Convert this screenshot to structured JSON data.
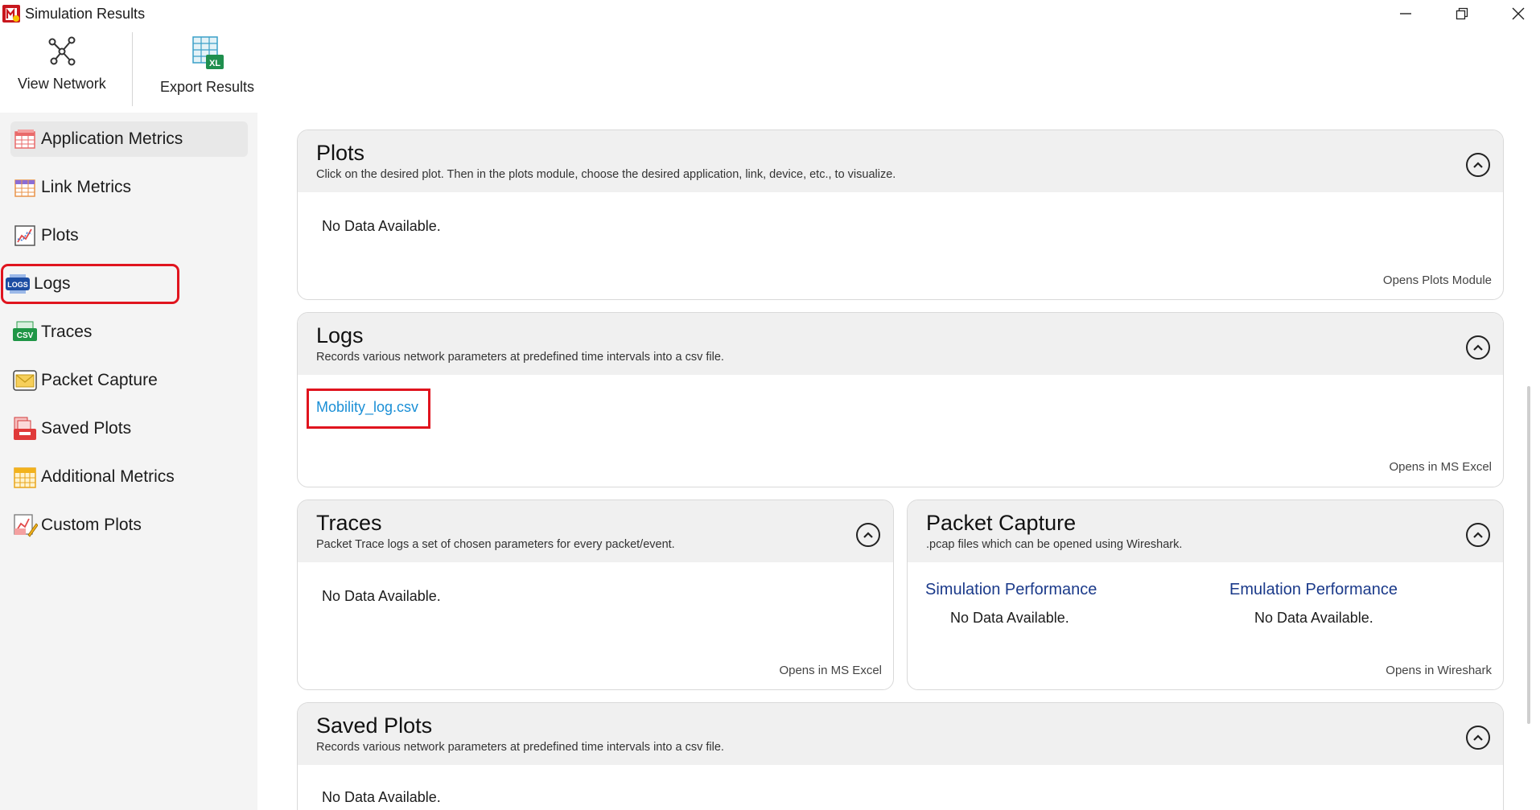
{
  "window": {
    "title": "Simulation Results"
  },
  "toolbar": {
    "view_network": "View Network",
    "export_results": "Export Results"
  },
  "sidebar": {
    "items": [
      {
        "label": "Application Metrics",
        "icon": "table-icon"
      },
      {
        "label": "Link Metrics",
        "icon": "table-icon"
      },
      {
        "label": "Plots",
        "icon": "chart-icon"
      },
      {
        "label": "Logs",
        "icon": "logs-icon"
      },
      {
        "label": "Traces",
        "icon": "csv-icon"
      },
      {
        "label": "Packet Capture",
        "icon": "envelope-icon"
      },
      {
        "label": "Saved Plots",
        "icon": "saved-plots-icon"
      },
      {
        "label": "Additional Metrics",
        "icon": "grid-icon"
      },
      {
        "label": "Custom Plots",
        "icon": "custom-plot-icon"
      }
    ]
  },
  "cards": {
    "plots": {
      "title": "Plots",
      "subtitle": "Click on the desired plot. Then in the plots module, choose the desired application, link, device, etc., to visualize.",
      "body": "No Data Available.",
      "footer": "Opens Plots Module"
    },
    "logs": {
      "title": "Logs",
      "subtitle": "Records various network parameters at predefined time intervals into a csv file.",
      "file": "Mobility_log.csv",
      "footer": "Opens in MS Excel"
    },
    "traces": {
      "title": "Traces",
      "subtitle": "Packet Trace logs a set of chosen parameters for every packet/event.",
      "body": "No Data Available.",
      "footer": "Opens in MS Excel"
    },
    "packet_capture": {
      "title": "Packet Capture",
      "subtitle": ".pcap files which can be opened using Wireshark.",
      "sim_title": "Simulation Performance",
      "sim_body": "No Data Available.",
      "emu_title": "Emulation Performance",
      "emu_body": "No Data Available.",
      "footer": "Opens in Wireshark"
    },
    "saved_plots": {
      "title": "Saved Plots",
      "subtitle": "Records various network parameters at predefined time intervals into a csv file.",
      "body": "No Data Available."
    }
  },
  "colors": {
    "highlight": "#e0141e",
    "link": "#1a8fd6",
    "subheading": "#1b3a8a"
  }
}
